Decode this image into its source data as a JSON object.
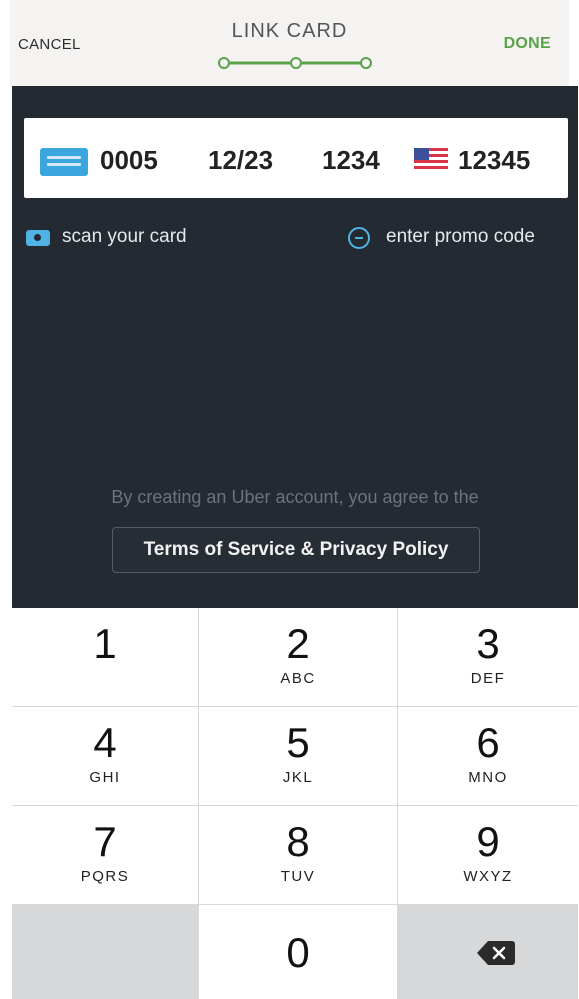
{
  "header": {
    "cancel_label": "CANCEL",
    "title": "LINK CARD",
    "done_label": "DONE",
    "progress_steps": 3
  },
  "card": {
    "number_last4": "0005",
    "expiry": "12/23",
    "cvv": "1234",
    "zip": "12345",
    "card_icon": "amex-card-icon",
    "flag_icon": "us-flag-icon"
  },
  "actions": {
    "scan_label": "scan your card",
    "promo_label": "enter promo code"
  },
  "legal": {
    "agree_text": "By creating an Uber account, you agree to the",
    "terms_label": "Terms of Service & Privacy Policy"
  },
  "keypad": {
    "keys": [
      {
        "digit": "1",
        "letters": ""
      },
      {
        "digit": "2",
        "letters": "ABC"
      },
      {
        "digit": "3",
        "letters": "DEF"
      },
      {
        "digit": "4",
        "letters": "GHI"
      },
      {
        "digit": "5",
        "letters": "JKL"
      },
      {
        "digit": "6",
        "letters": "MNO"
      },
      {
        "digit": "7",
        "letters": "PQRS"
      },
      {
        "digit": "8",
        "letters": "TUV"
      },
      {
        "digit": "9",
        "letters": "WXYZ"
      },
      {
        "digit": "0",
        "letters": ""
      }
    ],
    "delete_icon": "backspace-icon"
  },
  "colors": {
    "accent_green": "#5aa24a",
    "accent_blue": "#4fb3e6",
    "panel_bg": "#232a31"
  }
}
